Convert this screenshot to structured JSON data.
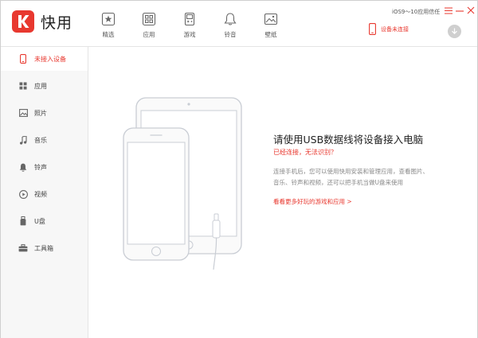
{
  "app": {
    "name": "快用",
    "brand_color": "#e8382f"
  },
  "nav": [
    {
      "label": "精选",
      "icon": "star-box-icon"
    },
    {
      "label": "应用",
      "icon": "apps-grid-icon"
    },
    {
      "label": "游戏",
      "icon": "gameboy-icon"
    },
    {
      "label": "铃音",
      "icon": "bell-icon"
    },
    {
      "label": "壁纸",
      "icon": "picture-icon"
    }
  ],
  "header": {
    "trust_text": "iOS9～10应用信任",
    "device_status": "设备未连接"
  },
  "sidebar": {
    "items": [
      {
        "label": "未接入设备",
        "icon": "phone-icon",
        "active": true
      },
      {
        "label": "应用",
        "icon": "apps-grid-icon"
      },
      {
        "label": "照片",
        "icon": "photo-icon"
      },
      {
        "label": "音乐",
        "icon": "music-note-icon"
      },
      {
        "label": "铃声",
        "icon": "bell-icon"
      },
      {
        "label": "视频",
        "icon": "play-circle-icon"
      },
      {
        "label": "U盘",
        "icon": "usb-drive-icon"
      },
      {
        "label": "工具箱",
        "icon": "toolbox-icon"
      }
    ]
  },
  "main": {
    "heading": "请使用USB数据线将设备接入电脑",
    "warning": "已经连接，无法识别？",
    "description": [
      "连接手机后，您可以使用快用安装和管理应用，查看图片、",
      "音乐、铃声和视频，还可以把手机当做U盘来使用"
    ],
    "more_link": "看看更多好玩的游戏和应用 >"
  }
}
